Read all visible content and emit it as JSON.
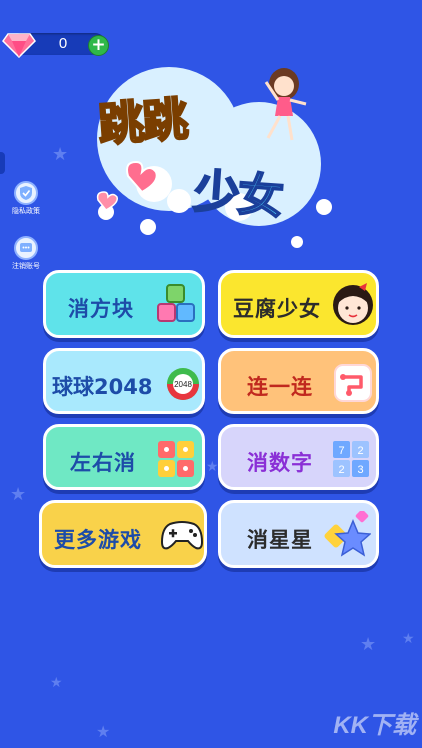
{
  "gems": {
    "count": "0",
    "plus": "+"
  },
  "side_buttons": [
    {
      "label": "隐私政策"
    },
    {
      "label": "注销账号"
    }
  ],
  "logo": {
    "line1": "跳跳",
    "line2": "少女"
  },
  "games": [
    {
      "label": "消方块"
    },
    {
      "label": "豆腐少女"
    },
    {
      "label": "球球2048"
    },
    {
      "label": "连一连"
    },
    {
      "label": "左右消"
    },
    {
      "label": "消数字"
    },
    {
      "label": "更多游戏"
    },
    {
      "label": "消星星"
    }
  ],
  "icon_text": {
    "ball_2048": "2048",
    "digits": [
      "7",
      "2",
      "2",
      "3"
    ]
  },
  "watermark": "KK下载",
  "colors": {
    "background": "#2f55e6",
    "cyan_button": "#5fe3ea",
    "yellow_button": "#fbe62e",
    "orange_button": "#ffc27a",
    "lavender_button": "#d7d5fb",
    "mint_button": "#6fe8c4",
    "gold_button": "#f9d24a"
  }
}
